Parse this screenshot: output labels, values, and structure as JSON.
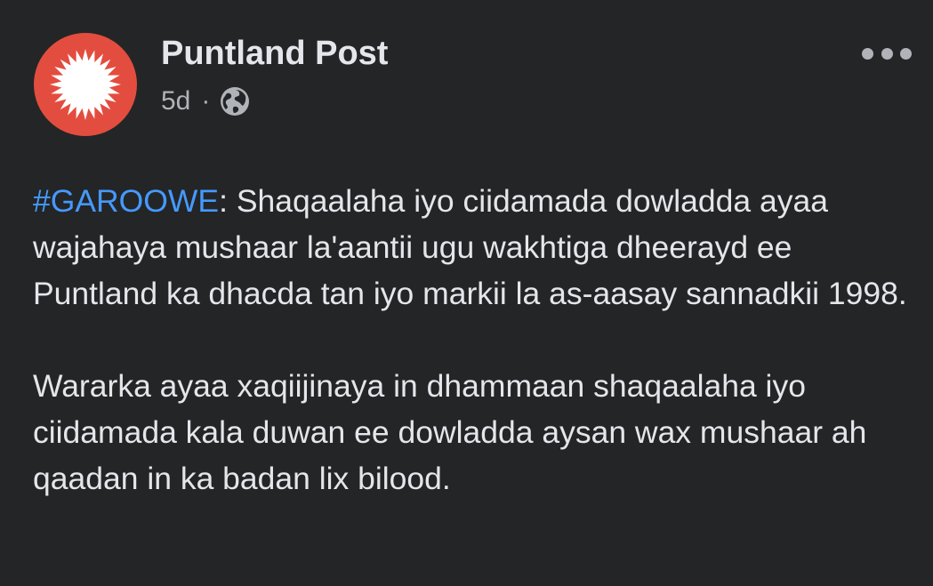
{
  "post": {
    "author": "Puntland Post",
    "time": "5d",
    "separator": "·",
    "audience_icon": "globe-icon",
    "more_icon": "ellipsis-icon",
    "paragraphs": [
      {
        "hashtag": "#GAROOWE",
        "text": ": Shaqaalaha iyo ciidamada dowladda ayaa wajahaya mushaar la'aantii ugu wakhtiga dheerayd ee Puntland ka dhacda tan iyo markii la as-aasay sannadkii 1998."
      },
      {
        "text": "Wararka ayaa xaqiijinaya in dhammaan shaqaalaha iyo ciidamada kala duwan ee dowladda aysan wax mushaar ah qaadan in ka badan lix bilood."
      }
    ]
  },
  "colors": {
    "background": "#242526",
    "text_primary": "#e4e6eb",
    "text_secondary": "#b0b3b8",
    "link": "#4599ff",
    "avatar": "#e34d3f"
  }
}
